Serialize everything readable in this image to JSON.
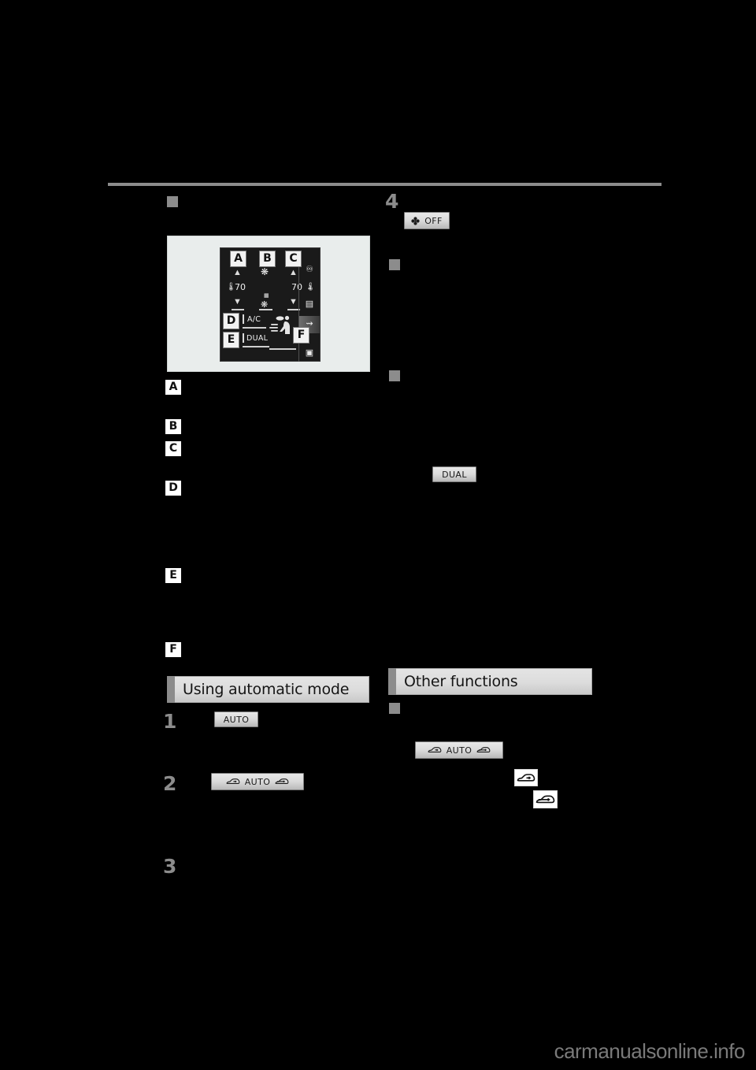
{
  "page": {
    "watermark": "carmanualsonline.info"
  },
  "figure": {
    "name": "climate-control-screen",
    "screen": {
      "left_temp": "70",
      "right_temp": "70",
      "ac_label": "A/C",
      "dual_label": "DUAL",
      "callouts": [
        "A",
        "B",
        "C",
        "D",
        "E",
        "F"
      ],
      "side_icons": [
        "headphones-icon",
        "music-note-icon",
        "media-icon",
        "seat-heater-icon",
        "display-icon"
      ]
    }
  },
  "left_column": {
    "bullet_top": "",
    "callouts": [
      "A",
      "B",
      "C",
      "D",
      "E",
      "F"
    ],
    "section": {
      "title": "Using automatic mode"
    },
    "steps": [
      {
        "number": "1",
        "chip": {
          "label": "AUTO",
          "icons": []
        }
      },
      {
        "number": "2",
        "chip": {
          "label": "AUTO",
          "icons": [
            "car-recirculate-icon",
            "car-fresh-air-icon"
          ]
        }
      },
      {
        "number": "3",
        "chip": null
      }
    ]
  },
  "right_column": {
    "step": {
      "number": "4",
      "chip": {
        "label": "OFF",
        "icons": [
          "fan-icon"
        ]
      }
    },
    "bullets": [
      "",
      ""
    ],
    "dual_chip": {
      "label": "DUAL"
    },
    "section": {
      "title": "Other functions"
    },
    "other": {
      "bullet": "",
      "auto_chip": {
        "label": "AUTO",
        "icons": [
          "car-recirculate-icon",
          "car-fresh-air-icon"
        ]
      },
      "icon_1": "car-recirculate-icon",
      "icon_2": "car-fresh-air-icon"
    }
  },
  "colors": {
    "page_bg": "#000000",
    "rule": "#8c8c8c",
    "marker": "#8c8c8c",
    "header_bg": "#dcdcdc",
    "chip_face": "#dadada",
    "figure_bg": "#e9edec",
    "screen_bg": "#1a1a1a"
  }
}
